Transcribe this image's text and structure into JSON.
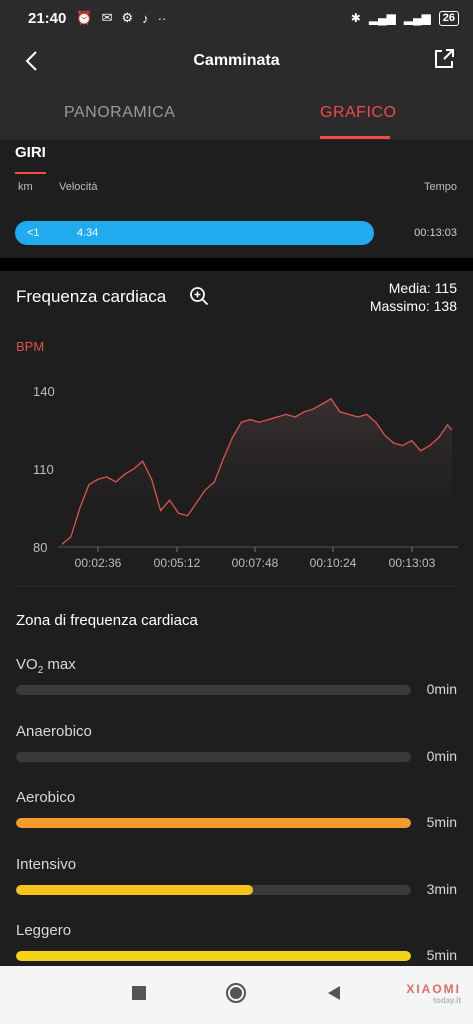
{
  "status_bar": {
    "time": "21:40",
    "battery": "26"
  },
  "header": {
    "title": "Camminata",
    "tabs": [
      {
        "label": "PANORAMICA",
        "active": false
      },
      {
        "label": "GRAFICO",
        "active": true
      }
    ]
  },
  "laps": {
    "title": "GIRI",
    "columns": {
      "km": "km",
      "speed": "Velocità",
      "time": "Tempo"
    },
    "rows": [
      {
        "km": "<1",
        "speed": "4.34",
        "time": "00:13:03"
      }
    ]
  },
  "heart_rate": {
    "title": "Frequenza cardiaca",
    "average_label": "Media: 115",
    "max_label": "Massimo: 138",
    "unit_label": "BPM"
  },
  "chart_data": {
    "type": "area",
    "ylabel": "BPM",
    "ylim": [
      80,
      140
    ],
    "y_ticks": [
      "140",
      "110",
      "80"
    ],
    "x_ticks": [
      "00:02:36",
      "00:05:12",
      "00:07:48",
      "00:10:24",
      "00:13:03"
    ],
    "x_minutes": [
      0,
      0.3,
      0.6,
      0.9,
      1.2,
      1.5,
      1.8,
      2.1,
      2.4,
      2.7,
      3.0,
      3.3,
      3.6,
      3.9,
      4.2,
      4.5,
      4.8,
      5.1,
      5.4,
      5.7,
      6.0,
      6.3,
      6.6,
      6.9,
      7.2,
      7.5,
      7.8,
      8.1,
      8.4,
      8.7,
      9.0,
      9.3,
      9.6,
      9.9,
      10.2,
      10.5,
      10.8,
      11.1,
      11.4,
      11.7,
      12.0,
      12.3,
      12.6,
      12.9,
      13.05
    ],
    "bpm": [
      81,
      84,
      95,
      104,
      106,
      107,
      105,
      108,
      110,
      113,
      106,
      94,
      98,
      93,
      92,
      97,
      102,
      105,
      114,
      122,
      128,
      129,
      128,
      129,
      130,
      131,
      130,
      132,
      133,
      135,
      137,
      132,
      131,
      130,
      131,
      128,
      123,
      120,
      119,
      121,
      117,
      119,
      122,
      127,
      125
    ],
    "line_color": "#e0524c",
    "grid": false
  },
  "zones": {
    "title": "Zona di frequenza cardiaca",
    "items": [
      {
        "label": "VO",
        "label_sub": "2",
        "label_suffix": " max",
        "value": "0min",
        "fraction": 0,
        "color": "#3a3a3a"
      },
      {
        "label": "Anaerobico",
        "label_sub": "",
        "label_suffix": "",
        "value": "0min",
        "fraction": 0,
        "color": "#3a3a3a"
      },
      {
        "label": "Aerobico",
        "label_sub": "",
        "label_suffix": "",
        "value": "5min",
        "fraction": 1.0,
        "color": "#f59a2c"
      },
      {
        "label": "Intensivo",
        "label_sub": "",
        "label_suffix": "",
        "value": "3min",
        "fraction": 0.6,
        "color": "#f7c21a"
      },
      {
        "label": "Leggero",
        "label_sub": "",
        "label_suffix": "",
        "value": "5min",
        "fraction": 1.0,
        "color": "#f5d318"
      }
    ]
  },
  "watermark": {
    "brand": "XIAOMI",
    "site": "today.it"
  },
  "nav_icons": [
    "recent-apps-icon",
    "home-icon",
    "back-icon"
  ]
}
